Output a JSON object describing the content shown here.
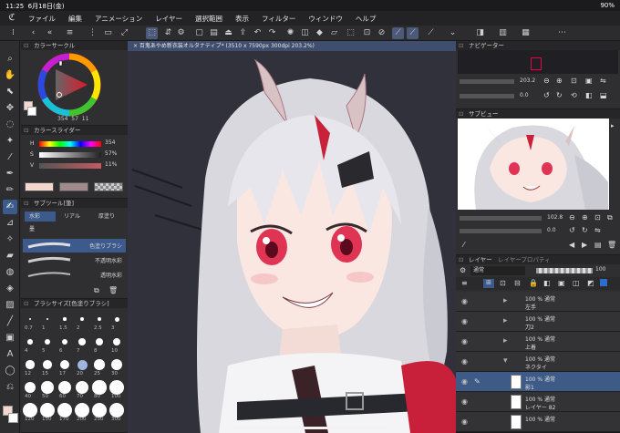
{
  "status": {
    "time": "11:25",
    "date": "6月18日(金)",
    "battery": "90%"
  },
  "menu": [
    "ファイル",
    "編集",
    "アニメーション",
    "レイヤー",
    "選択範囲",
    "表示",
    "フィルター",
    "ウィンドウ",
    "ヘルプ"
  ],
  "panels": {
    "color_circle": "カラーサークル",
    "color_values": {
      "h": "354",
      "s": "57",
      "v": "11"
    },
    "color_slider": "カラースライダー",
    "slider_labels": [
      "H",
      "S",
      "V"
    ],
    "slider_values": [
      "354",
      "57%",
      "11%"
    ],
    "subtool": "サブツール[筆]",
    "subtool_tabs": [
      "水彩",
      "リアル",
      "厚塗り",
      "墨"
    ],
    "brushes": [
      "色塗りブラシ",
      "不透明水彩",
      "透明水彩"
    ],
    "brush_size": "ブラシサイズ[色塗りブラシ]",
    "brush_sizes": [
      "0.7",
      "1",
      "1.5",
      "2",
      "2.5",
      "3",
      "4",
      "5",
      "6",
      "7",
      "8",
      "10",
      "12",
      "15",
      "17",
      "20",
      "25",
      "30",
      "40",
      "50",
      "60",
      "70",
      "80",
      "100",
      "120",
      "150",
      "170",
      "200",
      "250",
      "300"
    ],
    "navigator": "ナビゲーター",
    "nav_zoom": "203.2",
    "nav_angle": "0.0",
    "subview": "サブビュー",
    "subview_zoom": "102.8",
    "subview_angle": "0.0",
    "layer_tabs": [
      "レイヤー",
      "レイヤープロパティ"
    ],
    "blend_mode": "通常",
    "opacity": "100"
  },
  "document_tab": "× 百鬼あやめ新衣装オルタナティブ* (3510 x 7590px 300dpi 203.2%)",
  "layers": [
    {
      "name": "左手",
      "info": "100 % 通常",
      "kind": "folder"
    },
    {
      "name": "刀2",
      "info": "100 % 通常",
      "kind": "folder"
    },
    {
      "name": "上着",
      "info": "100 % 通常",
      "kind": "folder"
    },
    {
      "name": "ネクタイ",
      "info": "100 % 通常",
      "kind": "folder"
    },
    {
      "name": "影1",
      "info": "100 % 通常",
      "kind": "layer",
      "selected": true
    },
    {
      "name": "レイヤー 82",
      "info": "100 % 通常",
      "kind": "layer"
    },
    {
      "name": "",
      "info": "100 % 通常",
      "kind": "layer"
    }
  ],
  "colors": {
    "main": "#f4d8cf",
    "sub": "#ffffff",
    "accent": "#3d5a8c",
    "picked": "#c45a60"
  }
}
